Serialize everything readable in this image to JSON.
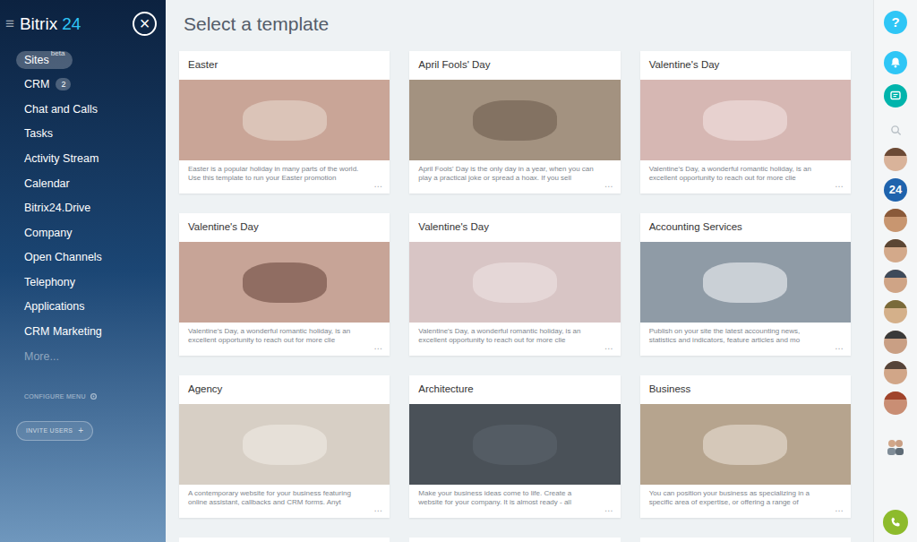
{
  "sidebar": {
    "menu_glyph": "≡",
    "logo_name": "Bitrix",
    "logo_number": "24",
    "close": "×",
    "items": [
      {
        "label": "Sites",
        "tag": "beta",
        "selected": true,
        "disabled": false
      },
      {
        "label": "CRM",
        "badge": "2",
        "selected": false,
        "disabled": false
      },
      {
        "label": "Chat and Calls",
        "selected": false,
        "disabled": false
      },
      {
        "label": "Tasks",
        "selected": false,
        "disabled": false
      },
      {
        "label": "Activity Stream",
        "selected": false,
        "disabled": false
      },
      {
        "label": "Calendar",
        "selected": false,
        "disabled": false
      },
      {
        "label": "Bitrix24.Drive",
        "selected": false,
        "disabled": false
      },
      {
        "label": "Company",
        "selected": false,
        "disabled": false
      },
      {
        "label": "Open Channels",
        "selected": false,
        "disabled": false
      },
      {
        "label": "Telephony",
        "selected": false,
        "disabled": false
      },
      {
        "label": "Applications",
        "selected": false,
        "disabled": false
      },
      {
        "label": "CRM Marketing",
        "selected": false,
        "disabled": false
      },
      {
        "label": "More...",
        "selected": false,
        "disabled": true
      }
    ],
    "configure": "CONFIGURE MENU",
    "invite": "INVITE USERS",
    "invite_icon": "+"
  },
  "title": "Select a template",
  "card_more": "…",
  "cards": [
    {
      "title": "Easter",
      "lines": [
        "Easter is a popular holiday in many parts of the world.",
        "Use this template to run your Easter promotion"
      ]
    },
    {
      "title": "April Fools' Day",
      "lines": [
        "April Fools' Day is the only day in a year, when you can",
        "play a practical joke or spread a hoax. If you sell"
      ]
    },
    {
      "title": "Valentine's Day",
      "lines": [
        "Valentine's Day, a wonderful romantic holiday, is an",
        "excellent opportunity to reach out for more clie"
      ]
    },
    {
      "title": "Valentine's Day",
      "lines": [
        "Valentine's Day, a wonderful romantic holiday, is an",
        "excellent opportunity to reach out for more clie"
      ]
    },
    {
      "title": "Valentine's Day",
      "lines": [
        "Valentine's Day, a wonderful romantic holiday, is an",
        "excellent opportunity to reach out for more clie"
      ]
    },
    {
      "title": "Accounting Services",
      "lines": [
        "Publish on your site the latest accounting news,",
        "statistics and indicators, feature articles and mo"
      ]
    },
    {
      "title": "Agency",
      "lines": [
        "A contemporary website for your business featuring",
        "online assistant, callbacks and CRM forms. Anyt"
      ]
    },
    {
      "title": "Architecture",
      "lines": [
        "Make your business ideas come to life. Create a",
        "website for your company. It is almost ready - all"
      ]
    },
    {
      "title": "Business",
      "lines": [
        "You can position your business as specializing in a",
        "specific area of expertise, or offering a range of"
      ]
    }
  ],
  "rightbar": {
    "help": "?",
    "avatar_badge": "24"
  }
}
